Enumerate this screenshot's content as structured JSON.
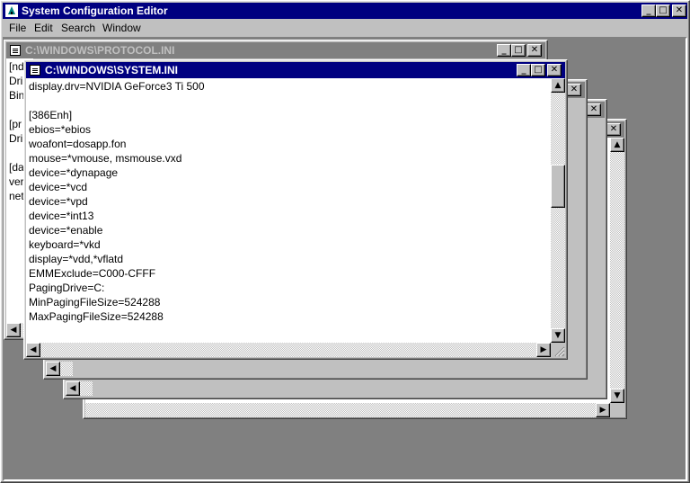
{
  "app": {
    "title": "System Configuration Editor",
    "controls": {
      "minimize": "_",
      "maximize": "□",
      "close": "✕"
    }
  },
  "menu": [
    {
      "label": "File"
    },
    {
      "label": "Edit"
    },
    {
      "label": "Search"
    },
    {
      "label": "Window"
    }
  ],
  "windows": {
    "protocol": {
      "title": "C:\\WINDOWS\\PROTOCOL.INI",
      "lines": [
        "[nd",
        "Dri",
        "Bin",
        "",
        "[pr",
        "Dri",
        "",
        "[da",
        "ver",
        "net"
      ]
    },
    "system": {
      "title": "C:\\WINDOWS\\SYSTEM.INI",
      "lines": [
        "display.drv=NVIDIA GeForce3 Ti 500",
        "",
        "[386Enh]",
        "ebios=*ebios",
        "woafont=dosapp.fon",
        "mouse=*vmouse, msmouse.vxd",
        "device=*dynapage",
        "device=*vcd",
        "device=*vpd",
        "device=*int13",
        "device=*enable",
        "keyboard=*vkd",
        "display=*vdd,*vflatd",
        "EMMExclude=C000-CFFF",
        "PagingDrive=C:",
        "MinPagingFileSize=524288",
        "MaxPagingFileSize=524288"
      ]
    }
  },
  "scroll": {
    "up": "▲",
    "down": "▼",
    "left": "◀",
    "right": "▶"
  },
  "colors": {
    "active_title": "#000080",
    "inactive_title": "#808080",
    "desktop": "#808080"
  }
}
